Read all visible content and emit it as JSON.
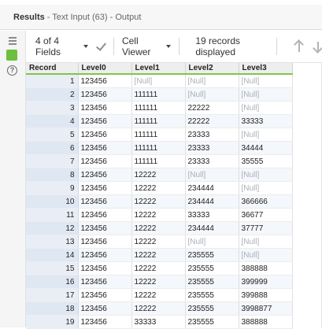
{
  "header": {
    "title_bold": "Results",
    "title_rest": "- Text Input (63) - Output"
  },
  "toolbar": {
    "fields_label": "4 of 4 Fields",
    "viewer_label": "Cell Viewer",
    "records_label": "19 records displayed"
  },
  "table": {
    "columns": [
      "Record",
      "Level0",
      "Level1",
      "Level2",
      "Level3"
    ],
    "rows": [
      [
        "1",
        "123456",
        "[Null]",
        "[Null]",
        "[Null]"
      ],
      [
        "2",
        "123456",
        "111111",
        "[Null]",
        "[Null]"
      ],
      [
        "3",
        "123456",
        "111111",
        "22222",
        "[Null]"
      ],
      [
        "4",
        "123456",
        "111111",
        "22222",
        "33333"
      ],
      [
        "5",
        "123456",
        "111111",
        "23333",
        "[Null]"
      ],
      [
        "6",
        "123456",
        "111111",
        "23333",
        "34444"
      ],
      [
        "7",
        "123456",
        "111111",
        "23333",
        "35555"
      ],
      [
        "8",
        "123456",
        "12222",
        "[Null]",
        "[Null]"
      ],
      [
        "9",
        "123456",
        "12222",
        "234444",
        "[Null]"
      ],
      [
        "10",
        "123456",
        "12222",
        "234444",
        "366666"
      ],
      [
        "11",
        "123456",
        "12222",
        "33333",
        "36677"
      ],
      [
        "12",
        "123456",
        "12222",
        "234444",
        "37777"
      ],
      [
        "13",
        "123456",
        "12222",
        "[Null]",
        "[Null]"
      ],
      [
        "14",
        "123456",
        "12222",
        "235555",
        "[Null]"
      ],
      [
        "15",
        "123456",
        "12222",
        "235555",
        "388888"
      ],
      [
        "16",
        "123456",
        "12222",
        "235555",
        "399999"
      ],
      [
        "17",
        "123456",
        "12222",
        "235555",
        "399888"
      ],
      [
        "18",
        "123456",
        "12222",
        "235555",
        "3998877"
      ],
      [
        "19",
        "123456",
        "33333",
        "235555",
        "388888"
      ]
    ]
  },
  "colors": {
    "accent_green": "#7fc64b",
    "null_text": "#aab0b8"
  },
  "icons": [
    "list-icon",
    "data-icon",
    "info-icon",
    "check-icon",
    "arrow-up-icon",
    "arrow-down-icon"
  ]
}
